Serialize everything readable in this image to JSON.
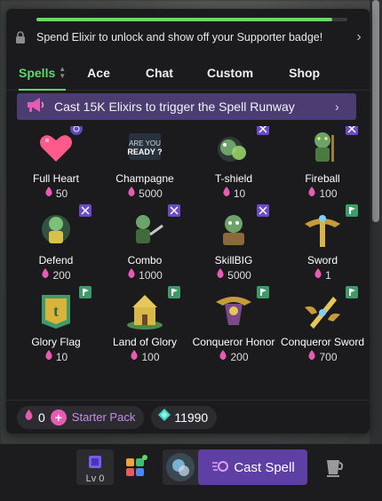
{
  "notice": {
    "text": "Spend Elixir to unlock and show off your Supporter badge!",
    "progress": 0.95
  },
  "tabs": [
    {
      "label": "Spells",
      "active": true
    },
    {
      "label": "Ace",
      "active": false
    },
    {
      "label": "Chat",
      "active": false
    },
    {
      "label": "Custom",
      "active": false
    },
    {
      "label": "Shop",
      "active": false
    }
  ],
  "banner": {
    "text": "Cast 15K Elixirs to trigger the Spell Runway"
  },
  "items": [
    {
      "name": "Full Heart",
      "price": "50",
      "icon": "heart-icon"
    },
    {
      "name": "Champagne",
      "price": "5000",
      "icon": "champagne-icon",
      "art_text": "ARE YOU READY ?"
    },
    {
      "name": "T-shield",
      "price": "10",
      "icon": "shield-goblin-icon"
    },
    {
      "name": "Fireball",
      "price": "100",
      "icon": "fireball-goblin-icon"
    },
    {
      "name": "Defend",
      "price": "200",
      "icon": "defend-goblin-icon"
    },
    {
      "name": "Combo",
      "price": "1000",
      "icon": "combo-goblin-icon"
    },
    {
      "name": "SkillBIG",
      "price": "5000",
      "icon": "skillbig-goblin-icon"
    },
    {
      "name": "Sword",
      "price": "1",
      "icon": "sword-icon"
    },
    {
      "name": "Glory Flag",
      "price": "10",
      "icon": "flag-icon"
    },
    {
      "name": "Land of Glory",
      "price": "100",
      "icon": "castle-icon"
    },
    {
      "name": "Conqueror Honor",
      "price": "200",
      "icon": "honor-icon"
    },
    {
      "name": "Conqueror Sword",
      "price": "700",
      "icon": "conqueror-sword-icon"
    }
  ],
  "footer": {
    "elixir_count": "0",
    "starter_pack": "Starter Pack",
    "gem_count": "11990"
  },
  "bottom_bar": {
    "level": "Lv 0",
    "cast_label": "Cast Spell"
  },
  "colors": {
    "accent_green": "#5fd86a",
    "banner_purple": "#4b3c72",
    "cast_purple": "#5e3fa3",
    "elixir_pink": "#e85bb5"
  }
}
